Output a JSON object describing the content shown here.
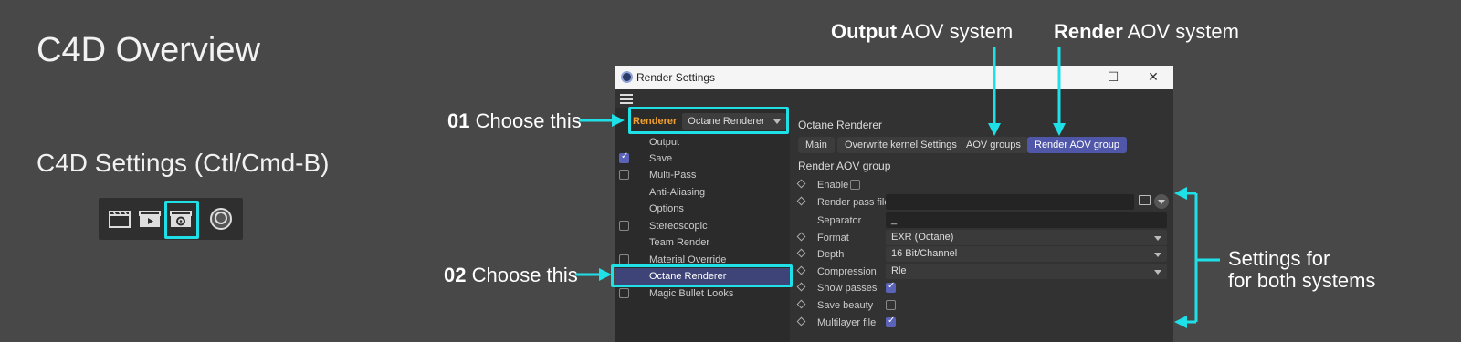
{
  "slide": {
    "title": "C4D Overview",
    "subtitle": "C4D Settings (Ctl/Cmd-B)"
  },
  "toolbar": {
    "icons": [
      "clapperboard-icon",
      "render-view-icon",
      "render-settings-icon",
      "picture-viewer-icon"
    ]
  },
  "annotations": {
    "step1_num": "01",
    "step1_text": " Choose this",
    "step2_num": "02",
    "step2_text": " Choose this",
    "output_bold": "Output",
    "output_rest": " AOV system",
    "render_bold": "Render",
    "render_rest": " AOV system",
    "settings_line1": "Settings for",
    "settings_line2": "for both systems"
  },
  "window": {
    "title": "Render Settings",
    "renderer_label": "Renderer",
    "renderer_value": "Octane Renderer",
    "nav": [
      {
        "label": "Output",
        "checkbox": "none"
      },
      {
        "label": "Save",
        "checkbox": "checked"
      },
      {
        "label": "Multi-Pass",
        "checkbox": "unchecked"
      },
      {
        "label": "Anti-Aliasing",
        "checkbox": "none"
      },
      {
        "label": "Options",
        "checkbox": "none"
      },
      {
        "label": "Stereoscopic",
        "checkbox": "unchecked"
      },
      {
        "label": "Team Render",
        "checkbox": "none"
      },
      {
        "label": "Material Override",
        "checkbox": "unchecked"
      },
      {
        "label": "Octane Renderer",
        "checkbox": "none",
        "selected": true
      },
      {
        "label": "Magic Bullet Looks",
        "checkbox": "unchecked"
      }
    ],
    "section_title": "Octane Renderer",
    "tabs": [
      "Main",
      "Overwrite kernel Settings",
      "AOV groups",
      "Render AOV group"
    ],
    "active_tab": "Render AOV group",
    "group_title": "Render AOV group",
    "props": {
      "enable": {
        "label": "Enable",
        "checked": false
      },
      "render_pass_file": {
        "label": "Render pass file",
        "value": ""
      },
      "separator": {
        "label": "Separator",
        "value": "_"
      },
      "format": {
        "label": "Format",
        "value": "EXR (Octane)"
      },
      "depth": {
        "label": "Depth",
        "value": "16 Bit/Channel"
      },
      "compression": {
        "label": "Compression",
        "value": "Rle"
      },
      "show_passes": {
        "label": "Show passes",
        "checked": true
      },
      "save_beauty": {
        "label": "Save beauty",
        "checked": false
      },
      "multilayer_file": {
        "label": "Multilayer file",
        "checked": true
      }
    }
  },
  "colors": {
    "highlight": "#1fe0e6",
    "background": "#484848",
    "active_tab": "#5157a8",
    "renderer_label": "#f0a030"
  }
}
